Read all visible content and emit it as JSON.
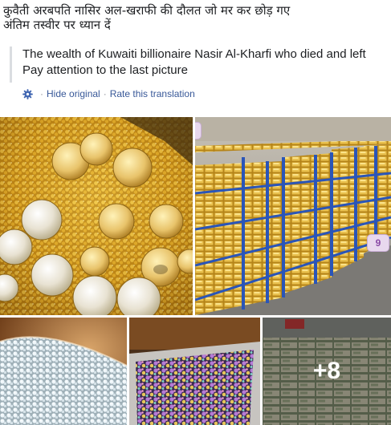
{
  "post": {
    "text_line1": "कुवैती अरबपति नासिर अल-खराफी की दौलत जो मर कर छोड़ गए",
    "text_line2": "अंतिम तस्वीर पर ध्यान दें"
  },
  "translation": {
    "line1": "The wealth of Kuwaiti billionaire Nasir Al-Kharfi who died and left",
    "line2": "Pay attention to the last picture",
    "hide_label": "Hide original",
    "separator": "·",
    "rate_label": "Rate this translation",
    "link_color": "#385898"
  },
  "gallery": {
    "photos": [
      {
        "alt": "gold coins and gold nuggets"
      },
      {
        "alt": "gold bars stacked on blue shelves"
      },
      {
        "alt": "crystals in a bowl"
      },
      {
        "alt": "tray of colorful gemstones"
      },
      {
        "alt": "stacks of banknotes"
      }
    ],
    "more_count": "+8",
    "badge_mid": "9"
  }
}
